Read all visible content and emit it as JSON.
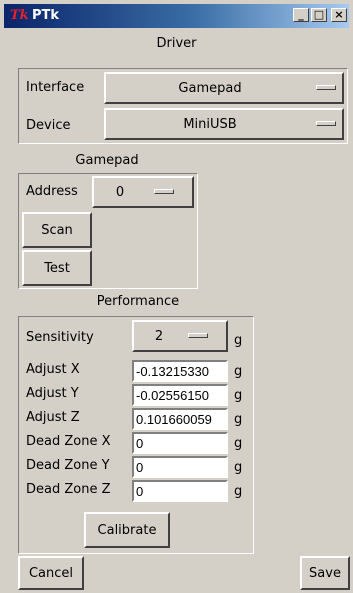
{
  "window": {
    "logo": "Tk",
    "title": "PTk",
    "minimize_glyph": "_",
    "maximize_glyph": "□",
    "close_glyph": "×"
  },
  "driver": {
    "title": "Driver",
    "interface_label": "Interface",
    "interface_value": "Gamepad",
    "device_label": "Device",
    "device_value": "MiniUSB"
  },
  "gamepad": {
    "title": "Gamepad",
    "address_label": "Address",
    "address_value": "0",
    "scan_label": "Scan",
    "test_label": "Test"
  },
  "performance": {
    "title": "Performance",
    "sensitivity_label": "Sensitivity",
    "sensitivity_value": "2",
    "unit": "g",
    "adjust_x_label": "Adjust X",
    "adjust_x_value": "-0.13215330",
    "adjust_y_label": "Adjust Y",
    "adjust_y_value": "-0.02556150",
    "adjust_z_label": "Adjust Z",
    "adjust_z_value": "0.101660059",
    "dead_x_label": "Dead Zone X",
    "dead_x_value": "0",
    "dead_y_label": "Dead Zone Y",
    "dead_y_value": "0",
    "dead_z_label": "Dead Zone Z",
    "dead_z_value": "0",
    "calibrate_label": "Calibrate"
  },
  "footer": {
    "cancel_label": "Cancel",
    "save_label": "Save"
  }
}
